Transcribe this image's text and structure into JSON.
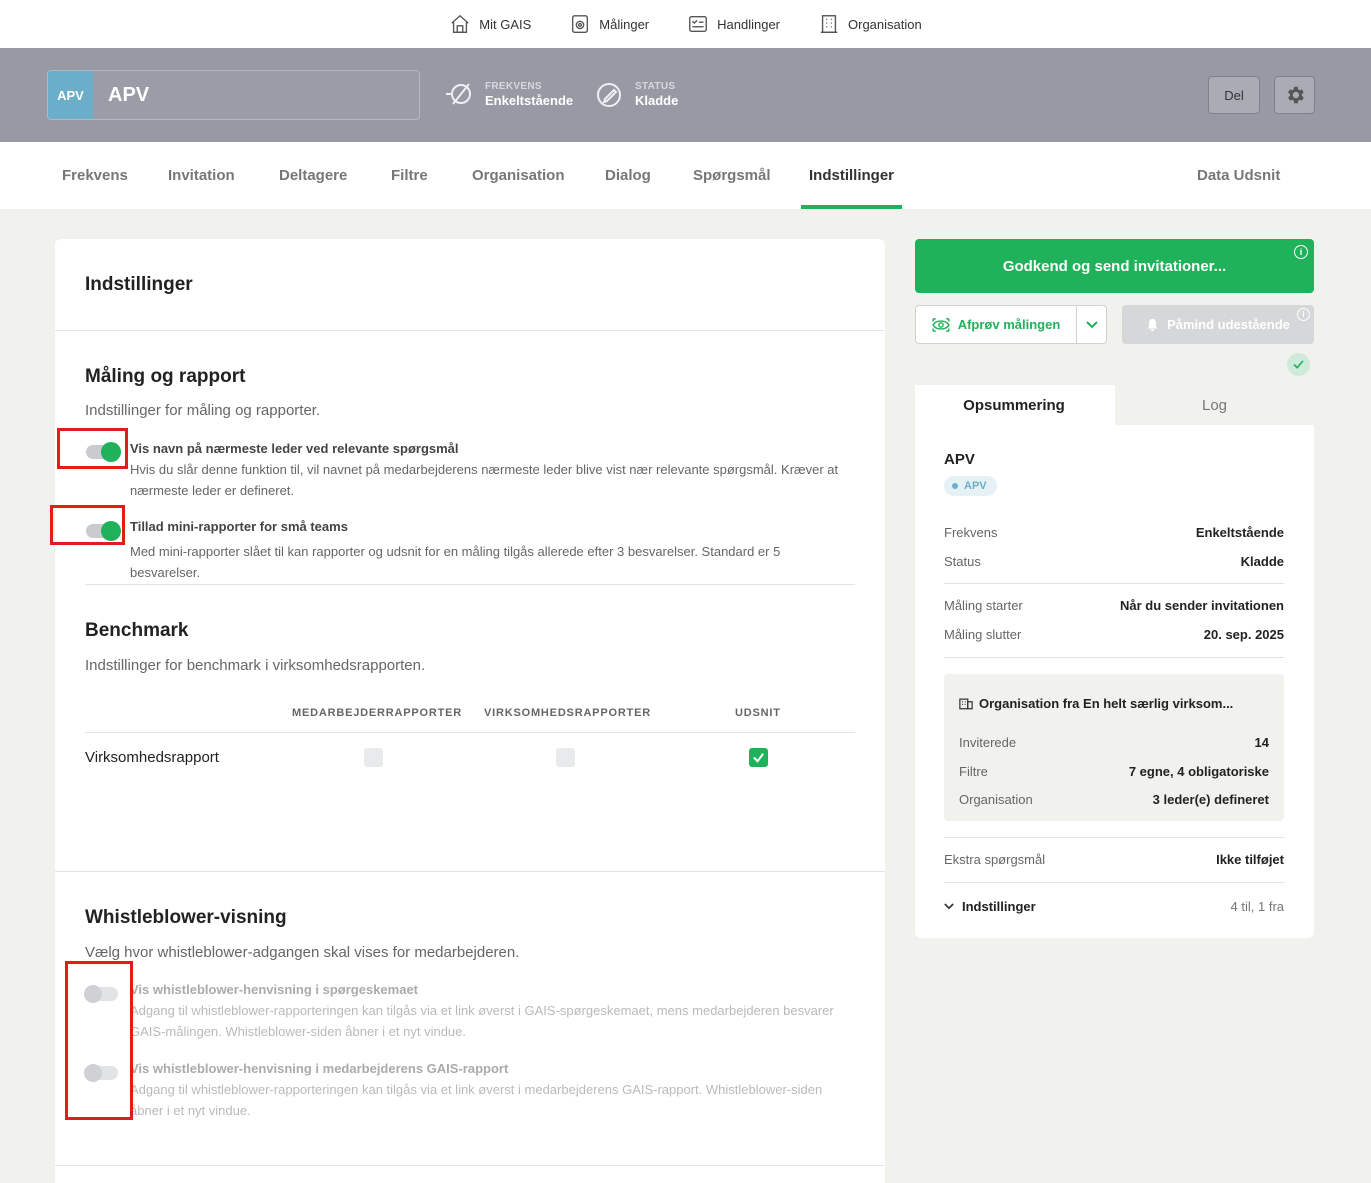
{
  "topnav": {
    "items": [
      {
        "label": "Mit GAIS",
        "icon": "home-icon"
      },
      {
        "label": "Målinger",
        "icon": "measurement-icon"
      },
      {
        "label": "Handlinger",
        "icon": "actions-icon"
      },
      {
        "label": "Organisation",
        "icon": "building-icon"
      }
    ]
  },
  "header": {
    "badge": "APV",
    "title": "APV",
    "frequency_label": "FREKVENS",
    "frequency_value": "Enkeltstående",
    "status_label": "STATUS",
    "status_value": "Kladde",
    "share_label": "Del"
  },
  "tabs": [
    "Frekvens",
    "Invitation",
    "Deltagere",
    "Filtre",
    "Organisation",
    "Dialog",
    "Spørgsmål",
    "Indstillinger",
    "Data Udsnit"
  ],
  "active_tab": "Indstillinger",
  "settings": {
    "title": "Indstillinger",
    "measurement": {
      "title": "Måling og rapport",
      "subtitle": "Indstillinger for måling og rapporter.",
      "options": [
        {
          "title": "Vis navn på nærmeste leder ved relevante spørgsmål",
          "desc": "Hvis du slår denne funktion til, vil navnet på medarbejderens nærmeste leder blive vist nær relevante spørgsmål. Kræver at nærmeste leder er defineret.",
          "enabled": true
        },
        {
          "title": "Tillad mini-rapporter for små teams",
          "desc": "Med mini-rapporter slået til kan rapporter og udsnit for en måling tilgås allerede efter 3 besvarelser. Standard er 5 besvarelser.",
          "enabled": true
        }
      ]
    },
    "benchmark": {
      "title": "Benchmark",
      "subtitle": "Indstillinger for benchmark i virksomhedsrapporten.",
      "columns": [
        "MEDARBEJDERRAPPORTER",
        "VIRKSOMHEDSRAPPORTER",
        "UDSNIT"
      ],
      "rows": [
        {
          "label": "Virksomhedsrapport",
          "values": [
            false,
            false,
            true
          ]
        }
      ]
    },
    "whistleblower": {
      "title": "Whistleblower-visning",
      "subtitle": "Vælg hvor whistleblower-adgangen skal vises for medarbejderen.",
      "options": [
        {
          "title": "Vis whistleblower-henvisning i spørgeskemaet",
          "desc": "Adgang til whistleblower-rapporteringen kan tilgås via et link øverst i GAIS-spørgeskemaet, mens medarbejderen besvarer GAIS-målingen. Whistleblower-siden åbner i et nyt vindue.",
          "enabled": false
        },
        {
          "title": "Vis whistleblower-henvisning i medarbejderens GAIS-rapport",
          "desc": "Adgang til whistleblower-rapporteringen kan tilgås via et link øverst i medarbejderens GAIS-rapport. Whistleblower-siden åbner i et nyt vindue.",
          "enabled": false
        }
      ]
    }
  },
  "actions": {
    "approve_label": "Godkend og send invitationer...",
    "tryout_label": "Afprøv målingen",
    "remind_label": "Påmind udestående"
  },
  "summary": {
    "tab_summary": "Opsummering",
    "tab_log": "Log",
    "title": "APV",
    "tag": "APV",
    "rows1": [
      {
        "k": "Frekvens",
        "v": "Enkeltstående"
      },
      {
        "k": "Status",
        "v": "Kladde"
      }
    ],
    "rows2": [
      {
        "k": "Måling starter",
        "v": "Når du sender invitationen"
      },
      {
        "k": "Måling slutter",
        "v": "20. sep. 2025"
      }
    ],
    "org": {
      "title": "Organisation fra En helt særlig virksom...",
      "rows": [
        {
          "k": "Inviterede",
          "v": "14"
        },
        {
          "k": "Filtre",
          "v": "7 egne, 4 obligatoriske"
        },
        {
          "k": "Organisation",
          "v": "3 leder(e) defineret"
        }
      ]
    },
    "extra": {
      "k": "Ekstra spørgsmål",
      "v": "Ikke tilføjet"
    },
    "settings": {
      "k": "Indstillinger",
      "v": "4 til, 1 fra"
    }
  },
  "colors": {
    "accent": "#1fb25a",
    "header_bg": "#979aa4",
    "badge_bg": "#6aaec9",
    "highlight": "#e21b1b"
  }
}
